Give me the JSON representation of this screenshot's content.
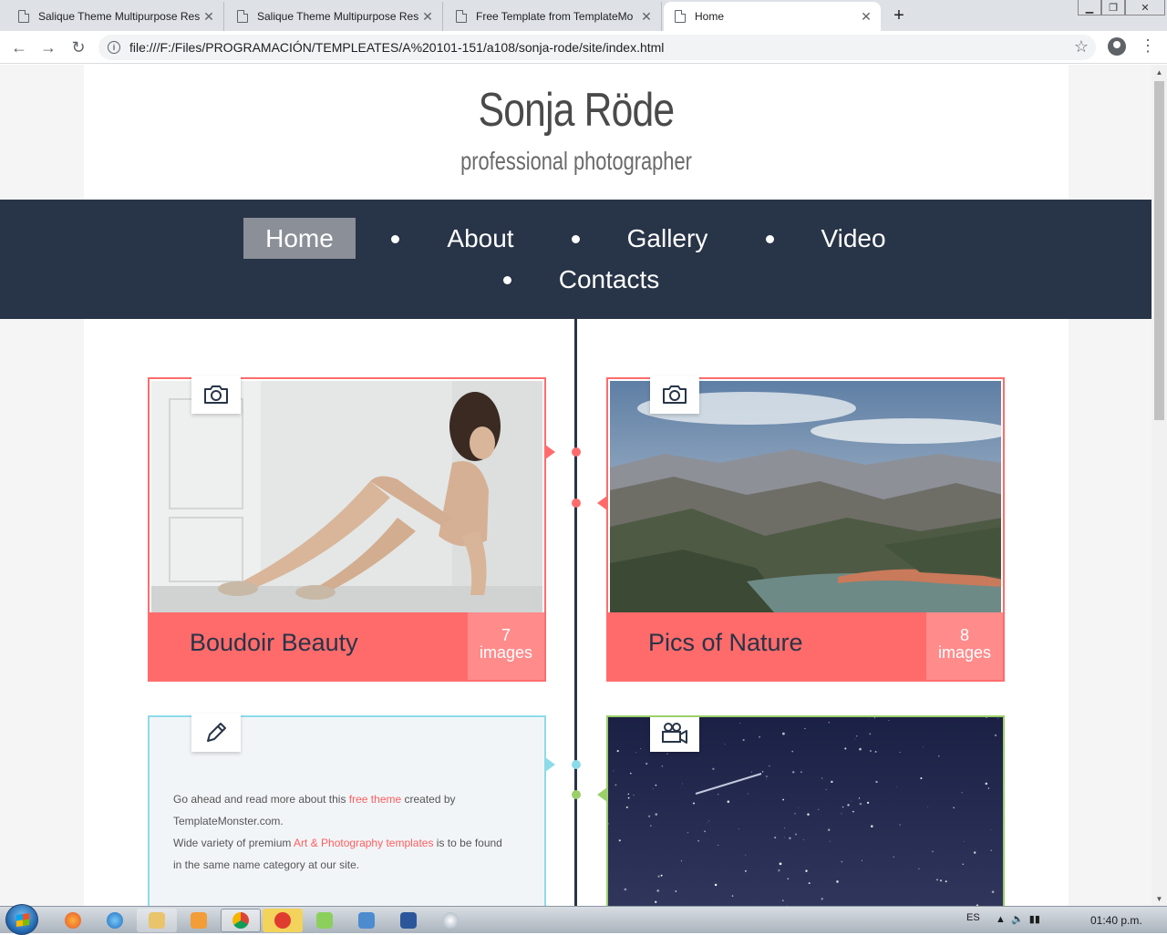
{
  "browser": {
    "tabs": [
      {
        "title": "Salique Theme Multipurpose Res",
        "close": "✕"
      },
      {
        "title": "Salique Theme Multipurpose Res",
        "close": "✕"
      },
      {
        "title": "Free Template from TemplateMo",
        "close": "✕"
      },
      {
        "title": "Home",
        "close": "✕"
      }
    ],
    "new_tab": "+",
    "url": "file:///F:/Files/PROGRAMACIÓN/TEMPLEATES/A%20101-151/a108/sonja-rode/site/index.html",
    "info_icon": "i",
    "back": "←",
    "forward": "→",
    "reload": "↻",
    "star": "☆",
    "menu": "⋮"
  },
  "header": {
    "title": "Sonja Röde",
    "subtitle": "professional photographer"
  },
  "nav": {
    "items": [
      "Home",
      "About",
      "Gallery",
      "Video",
      "Contacts"
    ],
    "active": "Home"
  },
  "cards": [
    {
      "title": "Boudoir Beauty",
      "count_num": "7",
      "count_label": "images",
      "icon": "camera-icon"
    },
    {
      "title": "Pics of Nature",
      "count_num": "8",
      "count_label": "images",
      "icon": "camera-icon"
    }
  ],
  "text_card": {
    "icon": "pencil-icon",
    "line1_pre": "Go ahead and read more about this ",
    "line1_link": "free theme",
    "line1_post": " created by",
    "line2": "TemplateMonster.com.",
    "line3_pre": "Wide variety of premium ",
    "line3_link": "Art & Photography templates",
    "line3_post": " is to be found",
    "line4": "in the same name category at our site."
  },
  "video_card": {
    "icon": "video-camera-icon"
  },
  "colors": {
    "nav_bg": "#283447",
    "accent_red": "#ff6b6b",
    "accent_blue": "#8ddbe9",
    "accent_green": "#9ccf6a"
  },
  "taskbar": {
    "lang": "ES",
    "clock": "01:40 p.m."
  }
}
